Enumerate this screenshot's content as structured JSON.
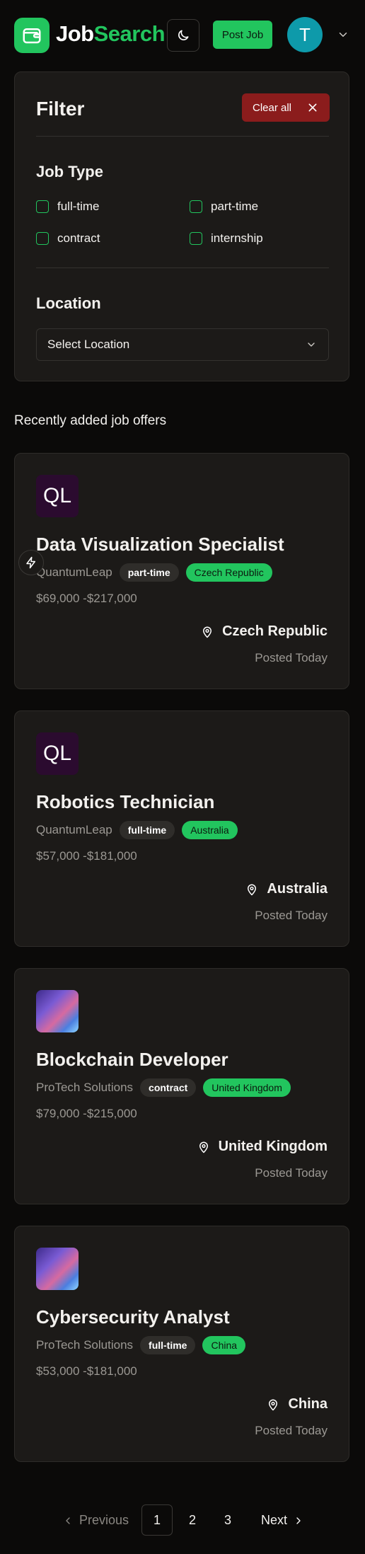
{
  "header": {
    "brand_part1": "Job",
    "brand_part2": "Search",
    "post_job_label": "Post Job",
    "avatar_initial": "T"
  },
  "filter": {
    "title": "Filter",
    "clear_label": "Clear all",
    "job_type_title": "Job Type",
    "job_types": [
      "full-time",
      "part-time",
      "contract",
      "internship"
    ],
    "location_title": "Location",
    "location_placeholder": "Select Location"
  },
  "recent_title": "Recently added job offers",
  "jobs": [
    {
      "logo": "QL",
      "title": "Data Visualization Specialist",
      "company": "QuantumLeap",
      "type": "part-time",
      "country": "Czech Republic",
      "salary": "$69,000 -$217,000",
      "location": "Czech Republic",
      "posted": "Posted Today"
    },
    {
      "logo": "QL",
      "title": "Robotics Technician",
      "company": "QuantumLeap",
      "type": "full-time",
      "country": "Australia",
      "salary": "$57,000 -$181,000",
      "location": "Australia",
      "posted": "Posted Today"
    },
    {
      "logo": "",
      "title": "Blockchain Developer",
      "company": "ProTech Solutions",
      "type": "contract",
      "country": "United Kingdom",
      "salary": "$79,000 -$215,000",
      "location": "United Kingdom",
      "posted": "Posted Today"
    },
    {
      "logo": "",
      "title": "Cybersecurity Analyst",
      "company": "ProTech Solutions",
      "type": "full-time",
      "country": "China",
      "salary": "$53,000 -$181,000",
      "location": "China",
      "posted": "Posted Today"
    }
  ],
  "pagination": {
    "previous_label": "Previous",
    "pages": [
      "1",
      "2",
      "3"
    ],
    "current_page": "1",
    "next_label": "Next"
  },
  "colors": {
    "accent": "#22c55e",
    "danger": "#8b1c1c",
    "avatar": "#0e9aaa",
    "card_bg": "#1c1a18",
    "page_bg": "#0b0a09"
  }
}
